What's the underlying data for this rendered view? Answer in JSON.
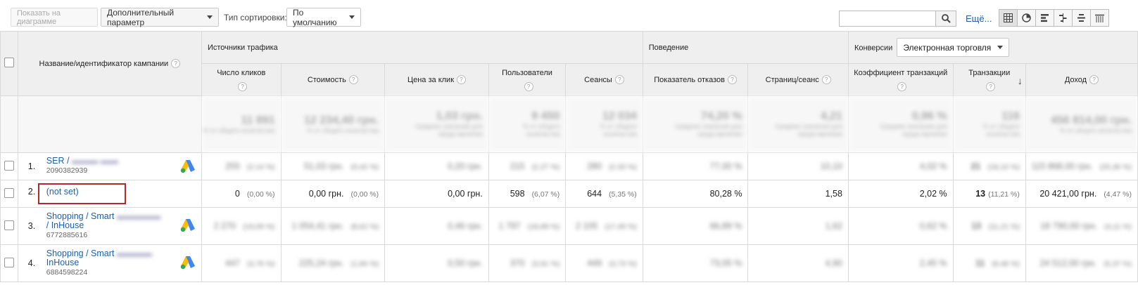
{
  "toolbar": {
    "plot_button": "Показать на диаграмме",
    "secondary_dim": "Дополнительный параметр",
    "sort_label": "Тип сортировки:",
    "sort_value": "По умолчанию",
    "search_placeholder": "",
    "more_link": "Ещё..."
  },
  "header": {
    "campaign_col": "Название/идентификатор кампании",
    "group_traffic": "Источники трафика",
    "group_behavior": "Поведение",
    "group_conversions": "Конверсии",
    "conversions_select": "Электронная торговля",
    "cols": [
      "Число кликов",
      "Стоимость",
      "Цена за клик",
      "Пользователи",
      "Сеансы",
      "Показатель отказов",
      "Страниц/сеанс",
      "Коэффициент транзакций",
      "Транзакции",
      "Доход"
    ]
  },
  "totals": {
    "values": [
      "11 891",
      "12 234,40 грн.",
      "1,03 грн.",
      "9 450",
      "12 034",
      "74,20 %",
      "4,21",
      "0,96 %",
      "116",
      "456 814,00 грн."
    ]
  },
  "rows": [
    {
      "idx": "1.",
      "name": "SER /",
      "id": "2090382939",
      "values": [
        "255",
        "(2,14 %)",
        "51,03 грн.",
        "(0,42 %)",
        "0,20 грн.",
        "215",
        "(2,27 %)",
        "280",
        "(2,33 %)",
        "77,00 %",
        "10,10",
        "4,02 %",
        "21",
        "(18,10 %)",
        "115 868,00 грн.",
        "(25,36 %)"
      ]
    },
    {
      "idx": "2.",
      "name": "(not set)",
      "clicks": "0",
      "clicks_pct": "(0,00 %)",
      "cost": "0,00 грн.",
      "cost_pct": "(0,00 %)",
      "cpc": "0,00 грн.",
      "users": "598",
      "users_pct": "(6,07 %)",
      "sessions": "644",
      "sessions_pct": "(5,35 %)",
      "bounce": "80,28 %",
      "pages": "1,58",
      "conv": "2,02 %",
      "trans": "13",
      "trans_pct": "(11,21 %)",
      "revenue": "20 421,00 грн.",
      "revenue_pct": "(4,47 %)"
    },
    {
      "idx": "3.",
      "name": "Shopping / Smart",
      "name2": "/ InHouse",
      "id": "6772885616",
      "values": [
        "2 270",
        "(19,09 %)",
        "1 054,41 грн.",
        "(8,62 %)",
        "0,46 грн.",
        "1 797",
        "(18,99 %)",
        "2 105",
        "(17,49 %)",
        "66,89 %",
        "1,62",
        "0,62 %",
        "13",
        "(11,21 %)",
        "18 790,00 грн.",
        "(4,11 %)"
      ]
    },
    {
      "idx": "4.",
      "name": "Shopping / Smart",
      "name2": "InHouse",
      "id": "6884598224",
      "values": [
        "447",
        "(3,76 %)",
        "225,24 грн.",
        "(1,84 %)",
        "0,50 грн.",
        "370",
        "(3,91 %)",
        "449",
        "(3,73 %)",
        "73,05 %",
        "4,90",
        "2,45 %",
        "11",
        "(9,48 %)",
        "24 512,00 грн.",
        "(5,37 %)"
      ]
    }
  ]
}
